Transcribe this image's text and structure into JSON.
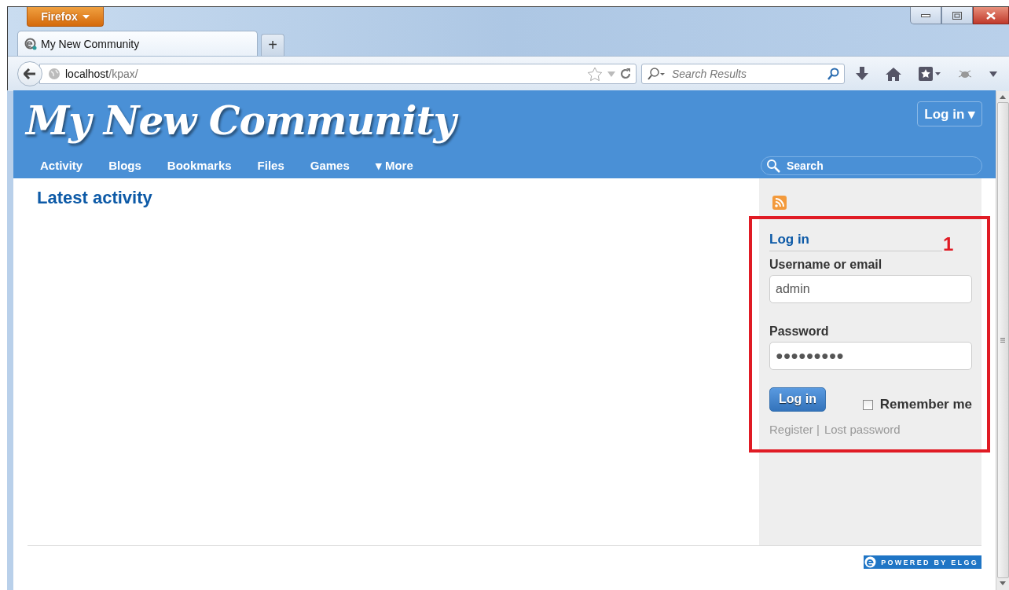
{
  "browser": {
    "menu_button": "Firefox",
    "tabs": [
      {
        "title": "My New Community",
        "selected": true
      }
    ],
    "new_tab": "+",
    "address": {
      "host": "localhost",
      "path": "/kpax/"
    },
    "search": {
      "placeholder": "Search Results"
    }
  },
  "site": {
    "title": "My New Community",
    "login_button": "Log in ▾",
    "nav": [
      "Activity",
      "Blogs",
      "Bookmarks",
      "Files",
      "Games",
      "▾ More"
    ],
    "search": {
      "placeholder": "Search"
    }
  },
  "main": {
    "heading": "Latest activity"
  },
  "login": {
    "title": "Log in",
    "fields": [
      {
        "label": "Username or email",
        "value": "admin"
      },
      {
        "label": "Password",
        "value": "●●●●●●●●●"
      }
    ],
    "submit": "Log in",
    "remember": {
      "label": "Remember me",
      "checked": false
    },
    "links": [
      "Register |",
      "Lost password"
    ]
  },
  "annotation": {
    "label": "1"
  },
  "footer": {
    "badge": "POWERED BY ELGG"
  }
}
